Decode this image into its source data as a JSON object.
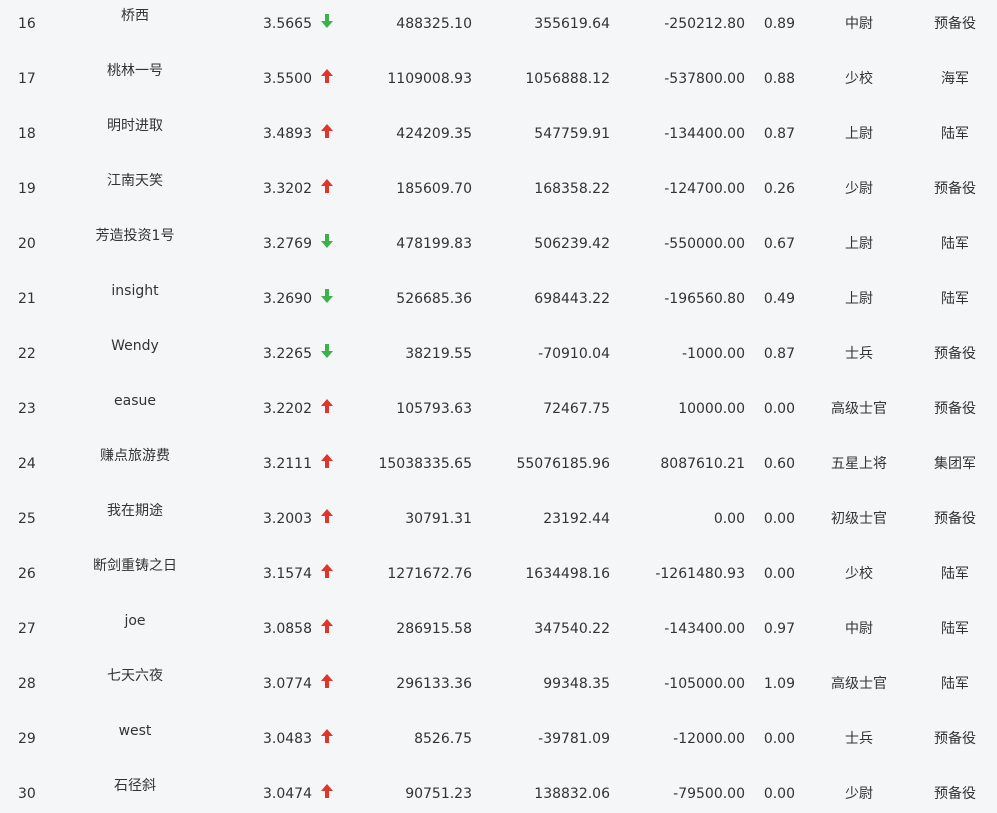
{
  "colors": {
    "up": "#e0352b",
    "down": "#3db14a",
    "text": "#333333",
    "background": "#f5f6f8"
  },
  "rows": [
    {
      "rank": "16",
      "name": "桥西",
      "ratio": "3.5665",
      "trend": "down",
      "v1": "488325.10",
      "v2": "355619.64",
      "v3": "-250212.80",
      "v4": "0.89",
      "title": "中尉",
      "group": "预备役"
    },
    {
      "rank": "17",
      "name": "桃林一号",
      "ratio": "3.5500",
      "trend": "up",
      "v1": "1109008.93",
      "v2": "1056888.12",
      "v3": "-537800.00",
      "v4": "0.88",
      "title": "少校",
      "group": "海军"
    },
    {
      "rank": "18",
      "name": "明时进取",
      "ratio": "3.4893",
      "trend": "up",
      "v1": "424209.35",
      "v2": "547759.91",
      "v3": "-134400.00",
      "v4": "0.87",
      "title": "上尉",
      "group": "陆军"
    },
    {
      "rank": "19",
      "name": "江南天笑",
      "ratio": "3.3202",
      "trend": "up",
      "v1": "185609.70",
      "v2": "168358.22",
      "v3": "-124700.00",
      "v4": "0.26",
      "title": "少尉",
      "group": "预备役"
    },
    {
      "rank": "20",
      "name": "芳造投资1号",
      "ratio": "3.2769",
      "trend": "down",
      "v1": "478199.83",
      "v2": "506239.42",
      "v3": "-550000.00",
      "v4": "0.67",
      "title": "上尉",
      "group": "陆军"
    },
    {
      "rank": "21",
      "name": "insight",
      "ratio": "3.2690",
      "trend": "down",
      "v1": "526685.36",
      "v2": "698443.22",
      "v3": "-196560.80",
      "v4": "0.49",
      "title": "上尉",
      "group": "陆军"
    },
    {
      "rank": "22",
      "name": "Wendy",
      "ratio": "3.2265",
      "trend": "down",
      "v1": "38219.55",
      "v2": "-70910.04",
      "v3": "-1000.00",
      "v4": "0.87",
      "title": "士兵",
      "group": "预备役"
    },
    {
      "rank": "23",
      "name": "easue",
      "ratio": "3.2202",
      "trend": "up",
      "v1": "105793.63",
      "v2": "72467.75",
      "v3": "10000.00",
      "v4": "0.00",
      "title": "高级士官",
      "group": "预备役"
    },
    {
      "rank": "24",
      "name": "赚点旅游费",
      "ratio": "3.2111",
      "trend": "up",
      "v1": "15038335.65",
      "v2": "55076185.96",
      "v3": "8087610.21",
      "v4": "0.60",
      "title": "五星上将",
      "group": "集团军"
    },
    {
      "rank": "25",
      "name": "我在期途",
      "ratio": "3.2003",
      "trend": "up",
      "v1": "30791.31",
      "v2": "23192.44",
      "v3": "0.00",
      "v4": "0.00",
      "title": "初级士官",
      "group": "预备役"
    },
    {
      "rank": "26",
      "name": "断剑重铸之日",
      "ratio": "3.1574",
      "trend": "up",
      "v1": "1271672.76",
      "v2": "1634498.16",
      "v3": "-1261480.93",
      "v4": "0.00",
      "title": "少校",
      "group": "陆军"
    },
    {
      "rank": "27",
      "name": "joe",
      "ratio": "3.0858",
      "trend": "up",
      "v1": "286915.58",
      "v2": "347540.22",
      "v3": "-143400.00",
      "v4": "0.97",
      "title": "中尉",
      "group": "陆军"
    },
    {
      "rank": "28",
      "name": "七天六夜",
      "ratio": "3.0774",
      "trend": "up",
      "v1": "296133.36",
      "v2": "99348.35",
      "v3": "-105000.00",
      "v4": "1.09",
      "title": "高级士官",
      "group": "陆军"
    },
    {
      "rank": "29",
      "name": "west",
      "ratio": "3.0483",
      "trend": "up",
      "v1": "8526.75",
      "v2": "-39781.09",
      "v3": "-12000.00",
      "v4": "0.00",
      "title": "士兵",
      "group": "预备役"
    },
    {
      "rank": "30",
      "name": "石径斜",
      "ratio": "3.0474",
      "trend": "up",
      "v1": "90751.23",
      "v2": "138832.06",
      "v3": "-79500.00",
      "v4": "0.00",
      "title": "少尉",
      "group": "预备役"
    }
  ]
}
